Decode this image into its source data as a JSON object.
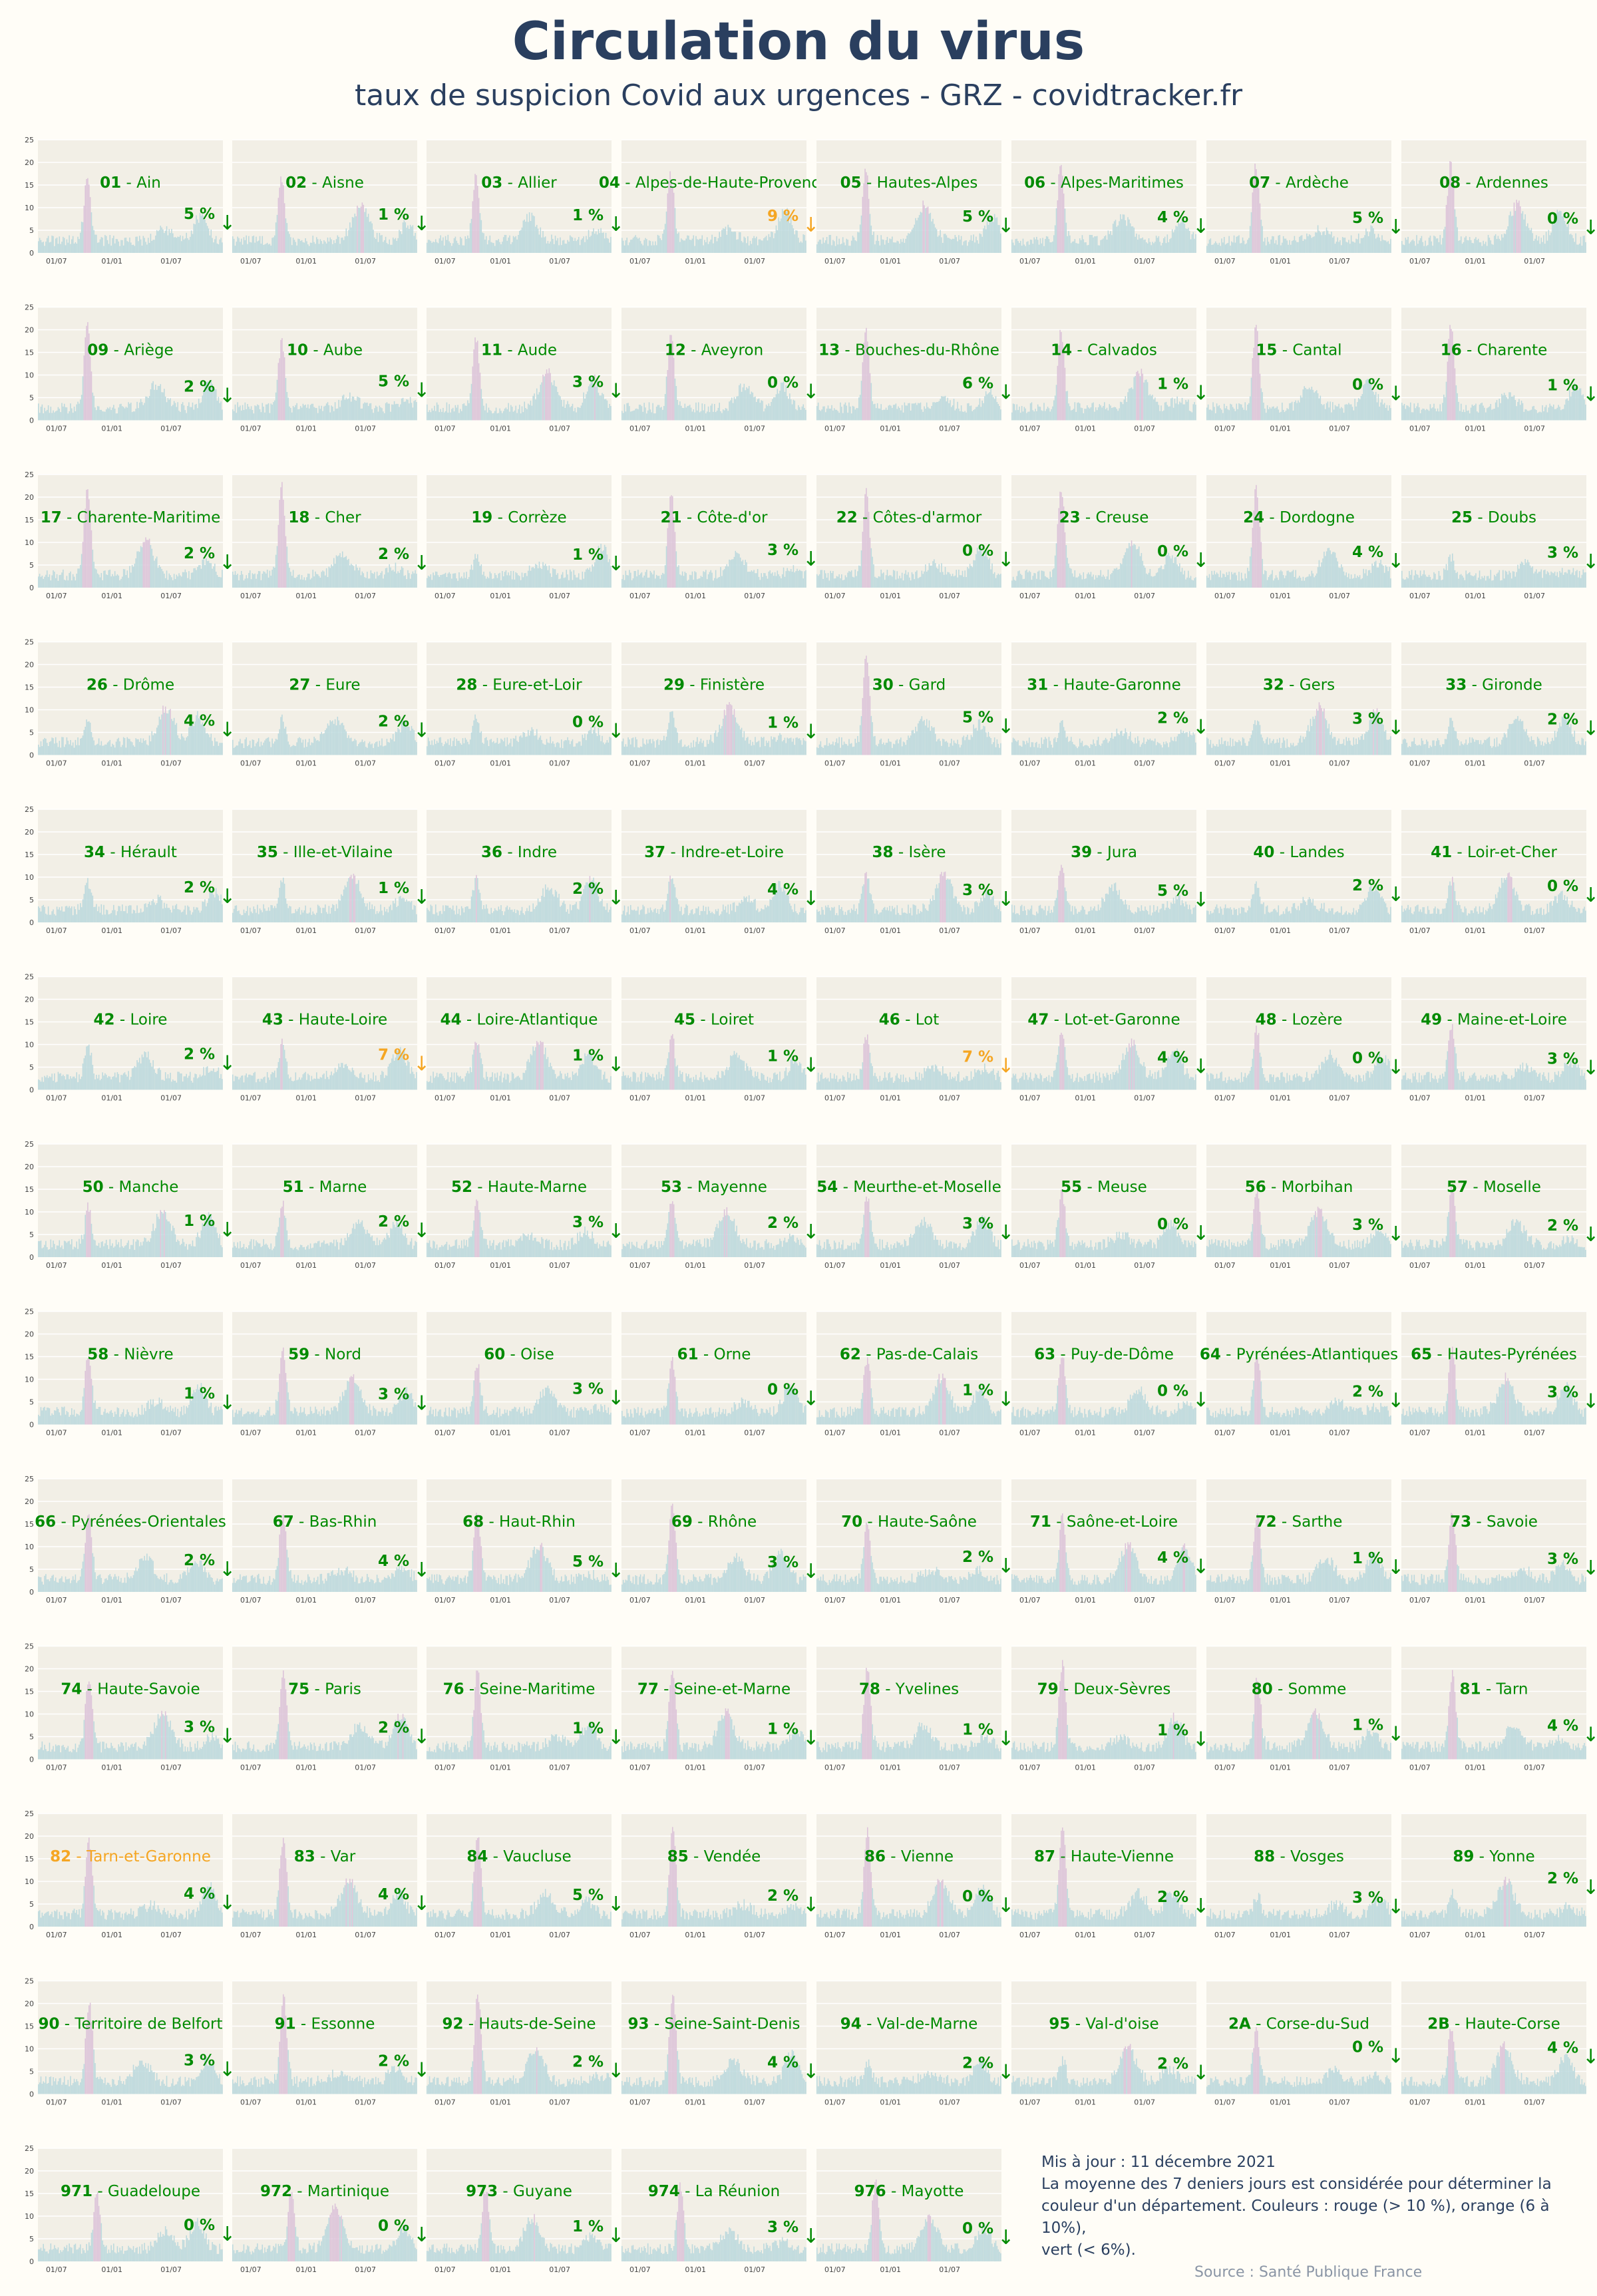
{
  "header": {
    "title": "Circulation du virus",
    "subtitle": "taux de suspicion Covid aux urgences - GRZ - covidtracker.fr"
  },
  "footer": {
    "updated": "Mis à jour : 11 décembre 2021",
    "note_line1": "La moyenne des 7 deniers jours est considérée pour déterminer la",
    "note_line2": "couleur d'un département. Couleurs : rouge (> 10 %), orange (6 à 10%),",
    "note_line3": "vert (< 6%).",
    "source": "Source : Santé Publique France"
  },
  "colors": {
    "background": "#fffdf7",
    "panel": "#f2efe6",
    "green": "#008a00",
    "orange": "#f5a623",
    "bars": "#bcd9dd",
    "bars_high": "#dcc3d9",
    "grid": "#ffffff",
    "text": "#2a3f5f"
  },
  "chart_data": {
    "type": "bar",
    "series_description": "Small multiples: one chart per département",
    "y_ticks": [
      "0",
      "5",
      "10",
      "15",
      "20",
      "25"
    ],
    "ylim": [
      0,
      25
    ],
    "x_ticks": [
      "01/07",
      "01/01",
      "01/07"
    ],
    "arrow": "↓",
    "departments": [
      {
        "code": "01",
        "name": "Ain",
        "value": "5 %",
        "status": "green"
      },
      {
        "code": "02",
        "name": "Aisne",
        "value": "1 %",
        "status": "green"
      },
      {
        "code": "03",
        "name": "Allier",
        "value": "1 %",
        "status": "green"
      },
      {
        "code": "04",
        "name": "Alpes-de-Haute-Provence",
        "value": "9 %",
        "status": "orange"
      },
      {
        "code": "05",
        "name": "Hautes-Alpes",
        "value": "5 %",
        "status": "green"
      },
      {
        "code": "06",
        "name": "Alpes-Maritimes",
        "value": "4 %",
        "status": "green"
      },
      {
        "code": "07",
        "name": "Ardèche",
        "value": "5 %",
        "status": "green"
      },
      {
        "code": "08",
        "name": "Ardennes",
        "value": "0 %",
        "status": "green"
      },
      {
        "code": "09",
        "name": "Ariège",
        "value": "2 %",
        "status": "green"
      },
      {
        "code": "10",
        "name": "Aube",
        "value": "5 %",
        "status": "green"
      },
      {
        "code": "11",
        "name": "Aude",
        "value": "3 %",
        "status": "green"
      },
      {
        "code": "12",
        "name": "Aveyron",
        "value": "0 %",
        "status": "green"
      },
      {
        "code": "13",
        "name": "Bouches-du-Rhône",
        "value": "6 %",
        "status": "green"
      },
      {
        "code": "14",
        "name": "Calvados",
        "value": "1 %",
        "status": "green"
      },
      {
        "code": "15",
        "name": "Cantal",
        "value": "0 %",
        "status": "green"
      },
      {
        "code": "16",
        "name": "Charente",
        "value": "1 %",
        "status": "green"
      },
      {
        "code": "17",
        "name": "Charente-Maritime",
        "value": "2 %",
        "status": "green"
      },
      {
        "code": "18",
        "name": "Cher",
        "value": "2 %",
        "status": "green"
      },
      {
        "code": "19",
        "name": "Corrèze",
        "value": "1 %",
        "status": "green"
      },
      {
        "code": "21",
        "name": "Côte-d'or",
        "value": "3 %",
        "status": "green"
      },
      {
        "code": "22",
        "name": "Côtes-d'armor",
        "value": "0 %",
        "status": "green"
      },
      {
        "code": "23",
        "name": "Creuse",
        "value": "0 %",
        "status": "green"
      },
      {
        "code": "24",
        "name": "Dordogne",
        "value": "4 %",
        "status": "green"
      },
      {
        "code": "25",
        "name": "Doubs",
        "value": "3 %",
        "status": "green"
      },
      {
        "code": "26",
        "name": "Drôme",
        "value": "4 %",
        "status": "green"
      },
      {
        "code": "27",
        "name": "Eure",
        "value": "2 %",
        "status": "green"
      },
      {
        "code": "28",
        "name": "Eure-et-Loir",
        "value": "0 %",
        "status": "green"
      },
      {
        "code": "29",
        "name": "Finistère",
        "value": "1 %",
        "status": "green"
      },
      {
        "code": "30",
        "name": "Gard",
        "value": "5 %",
        "status": "green"
      },
      {
        "code": "31",
        "name": "Haute-Garonne",
        "value": "2 %",
        "status": "green"
      },
      {
        "code": "32",
        "name": "Gers",
        "value": "3 %",
        "status": "green"
      },
      {
        "code": "33",
        "name": "Gironde",
        "value": "2 %",
        "status": "green"
      },
      {
        "code": "34",
        "name": "Hérault",
        "value": "2 %",
        "status": "green"
      },
      {
        "code": "35",
        "name": "Ille-et-Vilaine",
        "value": "1 %",
        "status": "green"
      },
      {
        "code": "36",
        "name": "Indre",
        "value": "2 %",
        "status": "green"
      },
      {
        "code": "37",
        "name": "Indre-et-Loire",
        "value": "4 %",
        "status": "green"
      },
      {
        "code": "38",
        "name": "Isère",
        "value": "3 %",
        "status": "green"
      },
      {
        "code": "39",
        "name": "Jura",
        "value": "5 %",
        "status": "green"
      },
      {
        "code": "40",
        "name": "Landes",
        "value": "2 %",
        "status": "green"
      },
      {
        "code": "41",
        "name": "Loir-et-Cher",
        "value": "0 %",
        "status": "green"
      },
      {
        "code": "42",
        "name": "Loire",
        "value": "2 %",
        "status": "green"
      },
      {
        "code": "43",
        "name": "Haute-Loire",
        "value": "7 %",
        "status": "orange"
      },
      {
        "code": "44",
        "name": "Loire-Atlantique",
        "value": "1 %",
        "status": "green"
      },
      {
        "code": "45",
        "name": "Loiret",
        "value": "1 %",
        "status": "green"
      },
      {
        "code": "46",
        "name": "Lot",
        "value": "7 %",
        "status": "orange"
      },
      {
        "code": "47",
        "name": "Lot-et-Garonne",
        "value": "4 %",
        "status": "green"
      },
      {
        "code": "48",
        "name": "Lozère",
        "value": "0 %",
        "status": "green"
      },
      {
        "code": "49",
        "name": "Maine-et-Loire",
        "value": "3 %",
        "status": "green"
      },
      {
        "code": "50",
        "name": "Manche",
        "value": "1 %",
        "status": "green"
      },
      {
        "code": "51",
        "name": "Marne",
        "value": "2 %",
        "status": "green"
      },
      {
        "code": "52",
        "name": "Haute-Marne",
        "value": "3 %",
        "status": "green"
      },
      {
        "code": "53",
        "name": "Mayenne",
        "value": "2 %",
        "status": "green"
      },
      {
        "code": "54",
        "name": "Meurthe-et-Moselle",
        "value": "3 %",
        "status": "green"
      },
      {
        "code": "55",
        "name": "Meuse",
        "value": "0 %",
        "status": "green"
      },
      {
        "code": "56",
        "name": "Morbihan",
        "value": "3 %",
        "status": "green"
      },
      {
        "code": "57",
        "name": "Moselle",
        "value": "2 %",
        "status": "green"
      },
      {
        "code": "58",
        "name": "Nièvre",
        "value": "1 %",
        "status": "green"
      },
      {
        "code": "59",
        "name": "Nord",
        "value": "3 %",
        "status": "green"
      },
      {
        "code": "60",
        "name": "Oise",
        "value": "3 %",
        "status": "green"
      },
      {
        "code": "61",
        "name": "Orne",
        "value": "0 %",
        "status": "green"
      },
      {
        "code": "62",
        "name": "Pas-de-Calais",
        "value": "1 %",
        "status": "green"
      },
      {
        "code": "63",
        "name": "Puy-de-Dôme",
        "value": "0 %",
        "status": "green"
      },
      {
        "code": "64",
        "name": "Pyrénées-Atlantiques",
        "value": "2 %",
        "status": "green"
      },
      {
        "code": "65",
        "name": "Hautes-Pyrénées",
        "value": "3 %",
        "status": "green"
      },
      {
        "code": "66",
        "name": "Pyrénées-Orientales",
        "value": "2 %",
        "status": "green"
      },
      {
        "code": "67",
        "name": "Bas-Rhin",
        "value": "4 %",
        "status": "green"
      },
      {
        "code": "68",
        "name": "Haut-Rhin",
        "value": "5 %",
        "status": "green"
      },
      {
        "code": "69",
        "name": "Rhône",
        "value": "3 %",
        "status": "green"
      },
      {
        "code": "70",
        "name": "Haute-Saône",
        "value": "2 %",
        "status": "green"
      },
      {
        "code": "71",
        "name": "Saône-et-Loire",
        "value": "4 %",
        "status": "green"
      },
      {
        "code": "72",
        "name": "Sarthe",
        "value": "1 %",
        "status": "green"
      },
      {
        "code": "73",
        "name": "Savoie",
        "value": "3 %",
        "status": "green"
      },
      {
        "code": "74",
        "name": "Haute-Savoie",
        "value": "3 %",
        "status": "green"
      },
      {
        "code": "75",
        "name": "Paris",
        "value": "2 %",
        "status": "green"
      },
      {
        "code": "76",
        "name": "Seine-Maritime",
        "value": "1 %",
        "status": "green"
      },
      {
        "code": "77",
        "name": "Seine-et-Marne",
        "value": "1 %",
        "status": "green"
      },
      {
        "code": "78",
        "name": "Yvelines",
        "value": "1 %",
        "status": "green"
      },
      {
        "code": "79",
        "name": "Deux-Sèvres",
        "value": "1 %",
        "status": "green"
      },
      {
        "code": "80",
        "name": "Somme",
        "value": "1 %",
        "status": "green"
      },
      {
        "code": "81",
        "name": "Tarn",
        "value": "4 %",
        "status": "green"
      },
      {
        "code": "82",
        "name": "Tarn-et-Garonne",
        "value": "4 %",
        "status": "green",
        "title_status": "orange"
      },
      {
        "code": "83",
        "name": "Var",
        "value": "4 %",
        "status": "green"
      },
      {
        "code": "84",
        "name": "Vaucluse",
        "value": "5 %",
        "status": "green"
      },
      {
        "code": "85",
        "name": "Vendée",
        "value": "2 %",
        "status": "green"
      },
      {
        "code": "86",
        "name": "Vienne",
        "value": "0 %",
        "status": "green"
      },
      {
        "code": "87",
        "name": "Haute-Vienne",
        "value": "2 %",
        "status": "green"
      },
      {
        "code": "88",
        "name": "Vosges",
        "value": "3 %",
        "status": "green"
      },
      {
        "code": "89",
        "name": "Yonne",
        "value": "2 %",
        "status": "green"
      },
      {
        "code": "90",
        "name": "Territoire de Belfort",
        "value": "3 %",
        "status": "green"
      },
      {
        "code": "91",
        "name": "Essonne",
        "value": "2 %",
        "status": "green"
      },
      {
        "code": "92",
        "name": "Hauts-de-Seine",
        "value": "2 %",
        "status": "green"
      },
      {
        "code": "93",
        "name": "Seine-Saint-Denis",
        "value": "4 %",
        "status": "green"
      },
      {
        "code": "94",
        "name": "Val-de-Marne",
        "value": "2 %",
        "status": "green"
      },
      {
        "code": "95",
        "name": "Val-d'oise",
        "value": "2 %",
        "status": "green"
      },
      {
        "code": "2A",
        "name": "Corse-du-Sud",
        "value": "0 %",
        "status": "green"
      },
      {
        "code": "2B",
        "name": "Haute-Corse",
        "value": "4 %",
        "status": "green"
      },
      {
        "code": "971",
        "name": "Guadeloupe",
        "value": "0 %",
        "status": "green"
      },
      {
        "code": "972",
        "name": "Martinique",
        "value": "0 %",
        "status": "green"
      },
      {
        "code": "973",
        "name": "Guyane",
        "value": "1 %",
        "status": "green"
      },
      {
        "code": "974",
        "name": "La Réunion",
        "value": "3 %",
        "status": "green"
      },
      {
        "code": "976",
        "name": "Mayotte",
        "value": "0 %",
        "status": "green"
      }
    ]
  }
}
